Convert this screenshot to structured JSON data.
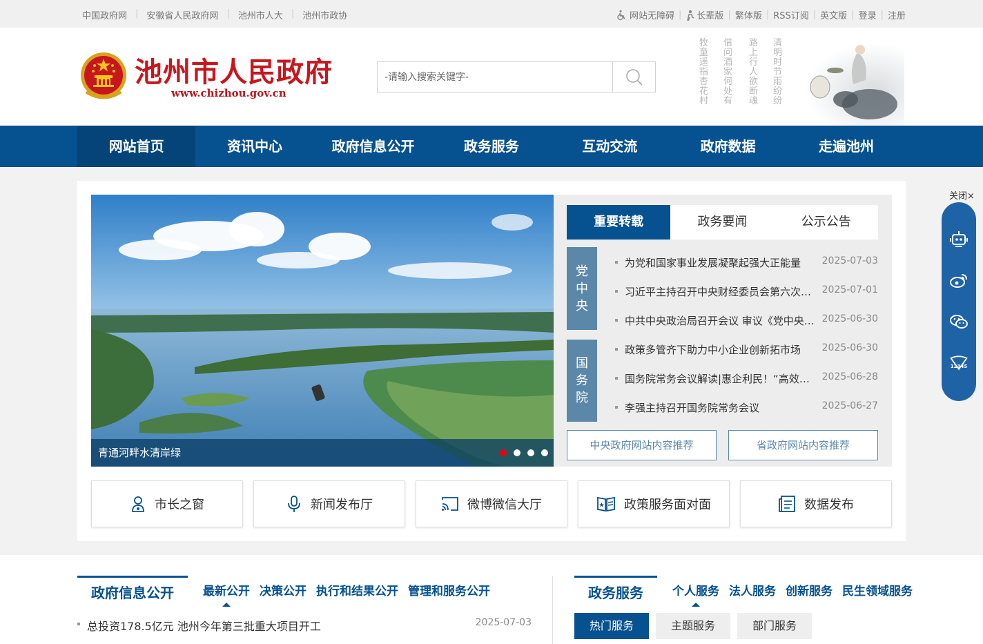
{
  "topbar": {
    "left_links": [
      "中国政府网",
      "安徽省人民政府网",
      "池州市人大",
      "池州市政协"
    ],
    "right_links": [
      "网站无障碍",
      "长辈版",
      "繁体版",
      "RSS订阅",
      "英文版",
      "登录",
      "注册"
    ]
  },
  "header": {
    "site_title": "池州市人民政府",
    "site_url": "www.chizhou.gov.cn",
    "search_placeholder": "-请输入搜索关键字-",
    "poem_columns": [
      "清明时节雨纷纷",
      "路上行人欲断魂",
      "借问酒家何处有",
      "牧童遥指杏花村"
    ]
  },
  "nav": {
    "items": [
      "网站首页",
      "资讯中心",
      "政府信息公开",
      "政务服务",
      "互动交流",
      "政府数据",
      "走遍池州"
    ],
    "active_index": 0
  },
  "slider": {
    "caption": "青通河畔水清岸绿",
    "slide_count": 4,
    "active_slide": 1
  },
  "news": {
    "tabs": [
      "重要转载",
      "政务要闻",
      "公示公告"
    ],
    "active_tab": 0,
    "groups": [
      {
        "tag": [
          "党",
          "中",
          "央"
        ],
        "items": [
          {
            "title": "为党和国家事业发展凝聚起强大正能量",
            "date": "2025-07-03"
          },
          {
            "title": "习近平主持召开中央财经委员会第六次会议",
            "date": "2025-07-01"
          },
          {
            "title": "中共中央政治局召开会议 审议《党中央决策议事协调机构工作条例》",
            "date": "2025-06-30"
          }
        ]
      },
      {
        "tag": [
          "国",
          "务",
          "院"
        ],
        "items": [
          {
            "title": "政策多管齐下助力中小企业创新拓市场",
            "date": "2025-06-30"
          },
          {
            "title": "国务院常务会议解读|惠企利民！“高效办成一件事”",
            "date": "2025-06-28"
          },
          {
            "title": "李强主持召开国务院常务会议",
            "date": "2025-06-27"
          }
        ]
      }
    ],
    "recommend_buttons": [
      "中央政府网站内容推荐",
      "省政府网站内容推荐"
    ]
  },
  "quick_links": [
    {
      "label": "市长之窗",
      "icon": "person-icon"
    },
    {
      "label": "新闻发布厅",
      "icon": "microphone-icon"
    },
    {
      "label": "微博微信大厅",
      "icon": "cast-icon"
    },
    {
      "label": "政策服务面对面",
      "icon": "book-icon"
    },
    {
      "label": "数据发布",
      "icon": "document-list-icon"
    }
  ],
  "info_open": {
    "title": "政府信息公开",
    "subtabs": [
      "最新公开",
      "决策公开",
      "执行和结果公开",
      "管理和服务公开"
    ],
    "active_subtab": 0,
    "items": [
      {
        "title": "总投资178.5亿元 池州今年第三批重大项目开工",
        "date": "2025-07-03"
      }
    ]
  },
  "gov_service": {
    "title": "政务服务",
    "subtabs": [
      "个人服务",
      "法人服务",
      "创新服务",
      "民生领域服务"
    ],
    "active_subtab": 0,
    "tabs": [
      "热门服务",
      "主题服务",
      "部门服务"
    ],
    "active_tab": 0
  },
  "side_widget": {
    "close_label": "关闭×",
    "icons": [
      "robot-icon",
      "weibo-icon",
      "wechat-icon",
      "hotline-12345-icon"
    ]
  },
  "colors": {
    "primary": "#06518f",
    "nav_active": "#044478",
    "title_red": "#c8161d",
    "tag_blue": "#5b87a8",
    "dot_active": "#e60012"
  }
}
